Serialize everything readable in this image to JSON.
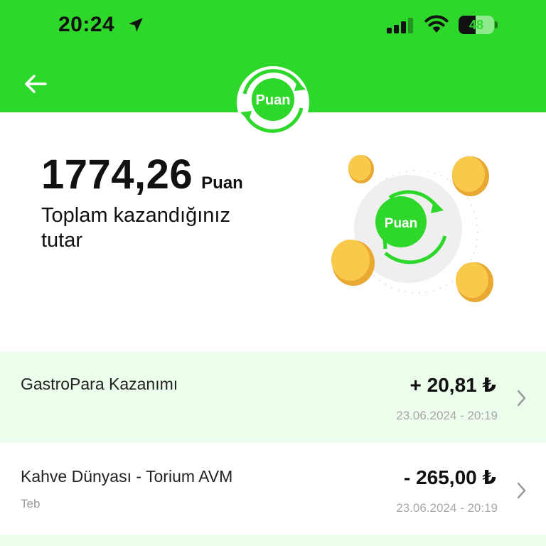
{
  "status_bar": {
    "time": "20:24",
    "battery": "48",
    "icons": [
      "location-arrow-icon",
      "cellular-signal-icon",
      "wifi-icon",
      "battery-icon"
    ]
  },
  "header": {
    "back_icon": "arrow-left-icon",
    "logo_text": "Puan"
  },
  "summary": {
    "amount": "1774,26",
    "unit": "Puan",
    "description": "Toplam kazandığınız tutar",
    "illustration_logo_text": "Puan"
  },
  "transactions": [
    {
      "title": "GastroPara Kazanımı",
      "subtitle": "",
      "amount": "+ 20,81 ₺",
      "date": "23.06.2024 - 20:19"
    },
    {
      "title": "Kahve Dünyası - Torium AVM",
      "subtitle": "Teb",
      "amount": "- 265,00 ₺",
      "date": "23.06.2024 - 20:19"
    }
  ],
  "colors": {
    "brand_green": "#2ed82a",
    "row_highlight": "#edfdec",
    "coin": "#f7c64a"
  }
}
